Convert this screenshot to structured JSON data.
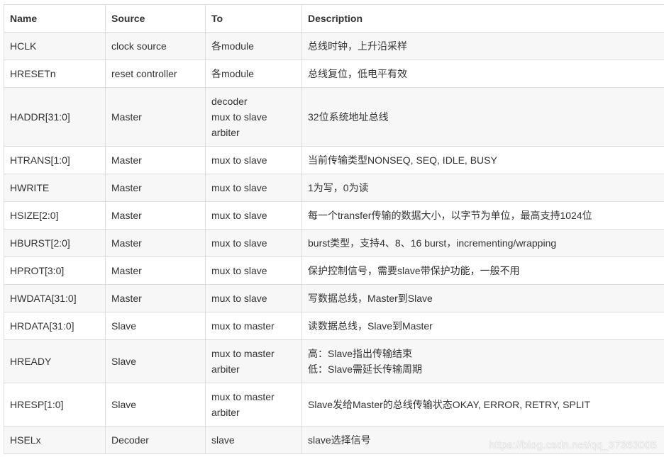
{
  "table": {
    "headers": [
      "Name",
      "Source",
      "To",
      "Description"
    ],
    "rows": [
      {
        "name": "HCLK",
        "source": "clock source",
        "to": [
          "各module"
        ],
        "desc": [
          "总线时钟，上升沿采样"
        ]
      },
      {
        "name": "HRESETn",
        "source": "reset controller",
        "to": [
          "各module"
        ],
        "desc": [
          "总线复位，低电平有效"
        ]
      },
      {
        "name": "HADDR[31:0]",
        "source": "Master",
        "to": [
          "decoder",
          "mux to slave",
          "arbiter"
        ],
        "desc": [
          "32位系统地址总线"
        ]
      },
      {
        "name": "HTRANS[1:0]",
        "source": "Master",
        "to": [
          "mux to slave"
        ],
        "desc": [
          "当前传输类型NONSEQ, SEQ, IDLE, BUSY"
        ]
      },
      {
        "name": "HWRITE",
        "source": "Master",
        "to": [
          "mux to slave"
        ],
        "desc": [
          "1为写，0为读"
        ]
      },
      {
        "name": "HSIZE[2:0]",
        "source": "Master",
        "to": [
          "mux to slave"
        ],
        "desc": [
          "每一个transfer传输的数据大小，以字节为单位，最高支持1024位"
        ]
      },
      {
        "name": "HBURST[2:0]",
        "source": "Master",
        "to": [
          "mux to slave"
        ],
        "desc": [
          "burst类型，支持4、8、16 burst，incrementing/wrapping"
        ]
      },
      {
        "name": "HPROT[3:0]",
        "source": "Master",
        "to": [
          "mux to slave"
        ],
        "desc": [
          "保护控制信号，需要slave带保护功能，一般不用"
        ]
      },
      {
        "name": "HWDATA[31:0]",
        "source": "Master",
        "to": [
          "mux to slave"
        ],
        "desc": [
          "写数据总线，Master到Slave"
        ]
      },
      {
        "name": "HRDATA[31:0]",
        "source": "Slave",
        "to": [
          "mux to master"
        ],
        "desc": [
          "读数据总线，Slave到Master"
        ]
      },
      {
        "name": "HREADY",
        "source": "Slave",
        "to": [
          "mux to master",
          "arbiter"
        ],
        "desc": [
          "高：Slave指出传输结束",
          "低：Slave需延长传输周期"
        ]
      },
      {
        "name": "HRESP[1:0]",
        "source": "Slave",
        "to": [
          "mux to master",
          "arbiter"
        ],
        "desc": [
          "Slave发给Master的总线传输状态OKAY, ERROR, RETRY, SPLIT"
        ]
      },
      {
        "name": "HSELx",
        "source": "Decoder",
        "to": [
          "slave"
        ],
        "desc": [
          "slave选择信号"
        ]
      }
    ]
  },
  "watermark": "https://blog.csdn.net/qq_37363005"
}
